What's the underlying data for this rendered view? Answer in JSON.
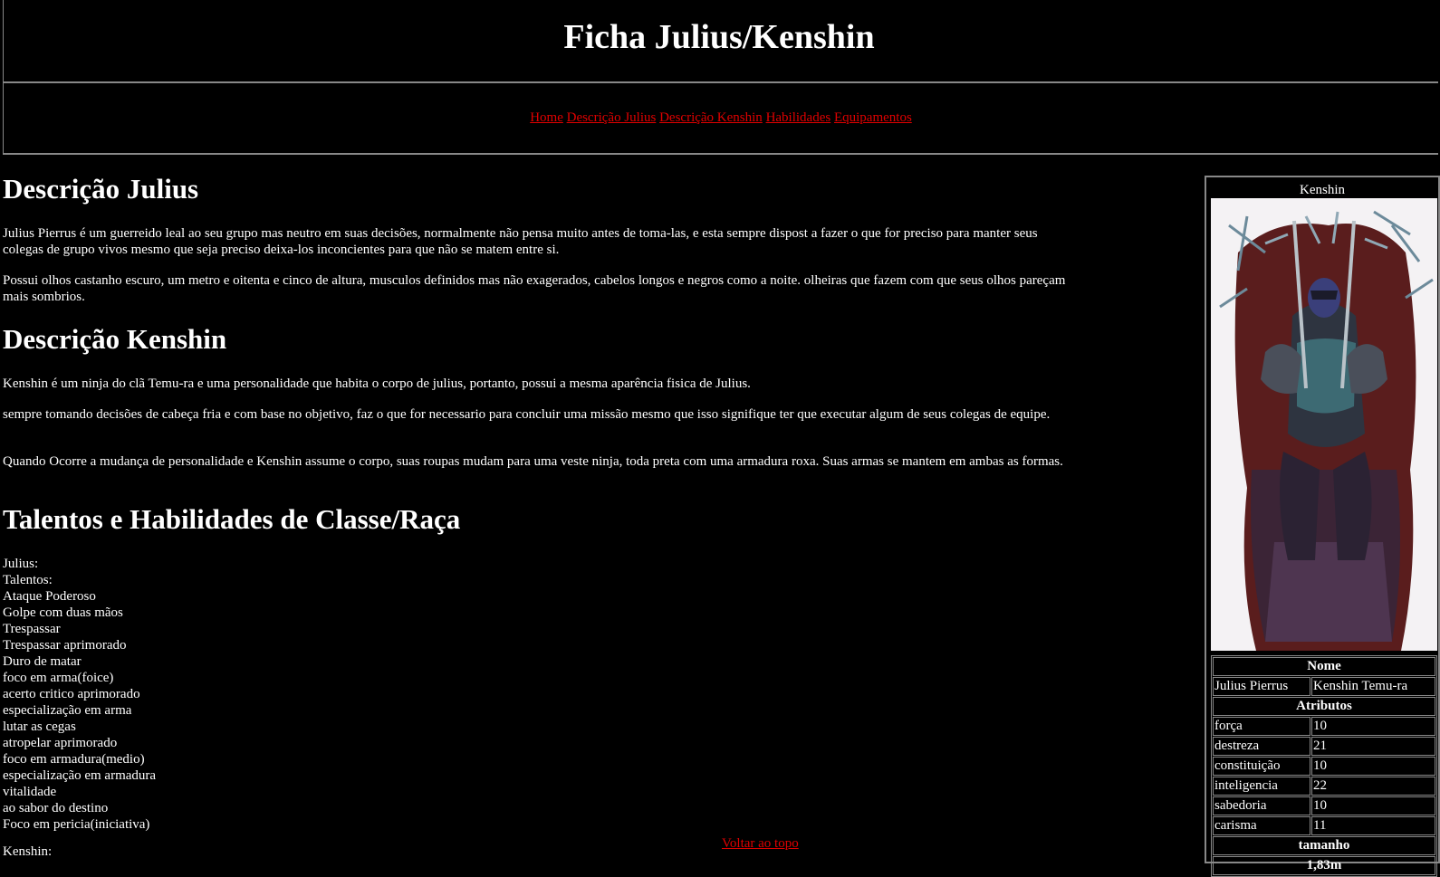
{
  "page": {
    "title": "Ficha Julius/Kenshin"
  },
  "nav": {
    "home": "Home",
    "desc_julius": "Descrição Julius",
    "desc_kenshin": "Descrição Kenshin",
    "habilidades": "Habilidades",
    "equipamentos": "Equipamentos"
  },
  "julius": {
    "heading": "Descrição Julius",
    "p1": "Julius Pierrus é um guerreido leal ao seu grupo mas neutro em suas decisões, normalmente não pensa muito antes de toma-las, e esta sempre dispost a fazer o que for preciso para manter seus colegas de grupo vivos mesmo que seja preciso deixa-los inconcientes para que não se matem entre si.",
    "p2": "Possui olhos castanho escuro, um metro e oitenta e cinco de altura, musculos definidos mas não exagerados, cabelos longos e negros como a noite. olheiras que fazem com que seus olhos pareçam mais sombrios."
  },
  "kenshin": {
    "heading": "Descrição Kenshin",
    "p1": "Kenshin é um ninja do clã Temu-ra e uma personalidade que habita o corpo de julius, portanto, possui a mesma aparência fisica de Julius.",
    "p2": "sempre tomando decisões de cabeça fria e com base no objetivo, faz o que for necessario para concluir uma missão mesmo que isso signifique ter que executar algum de seus colegas de equipe.",
    "p3": "Quando Ocorre a mudança de personalidade e Kenshin assume o corpo, suas roupas mudam para uma veste ninja, toda preta com uma armadura roxa. Suas armas se mantem em ambas as formas."
  },
  "talentos": {
    "heading": "Talentos e Habilidades de Classe/Raça",
    "lines": [
      "Julius:",
      "Talentos:",
      "Ataque Poderoso",
      "Golpe com duas mãos",
      "Trespassar",
      "Trespassar aprimorado",
      "Duro de matar",
      "foco em arma(foice)",
      "acerto critico aprimorado",
      "especialização em arma",
      "lutar as cegas",
      "atropelar aprimorado",
      "foco em armadura(medio)",
      "especialização em armadura",
      "vitalidade",
      "ao sabor do destino",
      "Foco em pericia(iniciativa)"
    ],
    "after": "Kenshin:"
  },
  "top_link": "Voltar ao topo",
  "sidebar": {
    "title": "Kenshin",
    "nome_header": "Nome",
    "nome_julius": "Julius Pierrus",
    "nome_kenshin": "Kenshin Temu-ra",
    "atributos_header": "Atributos",
    "atributos": [
      {
        "label": "força",
        "value": "10"
      },
      {
        "label": "destreza",
        "value": "21"
      },
      {
        "label": "constituição",
        "value": "10"
      },
      {
        "label": "inteligencia",
        "value": "22"
      },
      {
        "label": "sabedoria",
        "value": "10"
      },
      {
        "label": "carisma",
        "value": "11"
      }
    ],
    "tamanho_header": "tamanho",
    "tamanho_value": "1,83m"
  },
  "colors": {
    "background": "#000000",
    "text": "#ffffff",
    "link": "#e00000",
    "border": "#888888"
  }
}
